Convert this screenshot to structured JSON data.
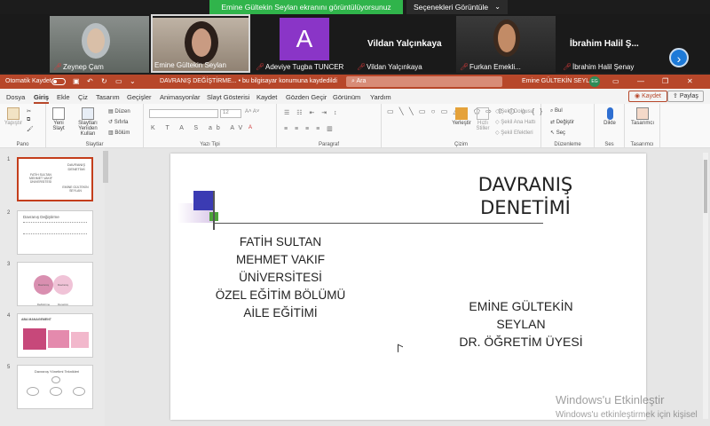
{
  "meeting": {
    "share_status": "Emine Gültekin Seylan ekranını görüntülüyorsunuz",
    "view_options": "Seçenekleri Görüntüle",
    "participants": [
      {
        "name": "Zeynep Çam"
      },
      {
        "name": "Emine Gültekin Seylan"
      },
      {
        "name": "Adeviye Tugba TUNCER",
        "avatar_letter": "A"
      },
      {
        "name": "Vildan Yalçınkaya",
        "display_name": "Vildan Yalçınkaya"
      },
      {
        "name": "Furkan Emekli..."
      },
      {
        "name": "İbrahim Halil Şenay",
        "display_name": "İbrahim  Halil  Ş..."
      }
    ]
  },
  "ppt": {
    "autosave": "Otomatik Kaydet",
    "doc_title": "DAVRANIŞ DEĞİŞTİRME...",
    "doc_status": "• bu bilgisayar konumuna kaydedildi",
    "search_placeholder": "Ara",
    "user_name": "Emine GÜLTEKİN SEYLAN",
    "user_initials": "EG",
    "menu": [
      "Dosya",
      "Giriş",
      "Ekle",
      "Çiz",
      "Tasarım",
      "Geçişler",
      "Animasyonlar",
      "Slayt Gösterisi",
      "Kaydet",
      "Gözden Geçir",
      "Görünüm",
      "Yardım"
    ],
    "save_btn": "Kaydet",
    "share_btn": "Paylaş",
    "ribbon": {
      "paste": "Yapıştır",
      "clipboard": "Pano",
      "new_slide": "Yeni Slayt",
      "reuse_slides": "Slaytları Yeniden Kullan",
      "layout": "Düzen",
      "reset": "Sıfırla",
      "section": "Bölüm",
      "slides": "Slaytlar",
      "font_size": "12",
      "font": "Yazı Tipi",
      "paragraph": "Paragraf",
      "arrange": "Yerleştir",
      "quick_styles": "Hızlı Stiller",
      "shape_fill": "Şekil Dolgusu",
      "shape_outline": "Şekil Ana Hattı",
      "shape_effects": "Şekil Efektleri",
      "drawing": "Çizim",
      "find": "Bul",
      "replace": "Değiştir",
      "select": "Seç",
      "editing": "Düzenleme",
      "dictate": "Dikte",
      "voice": "Ses",
      "designer": "Tasarımcı",
      "designer_group": "Tasarımcı"
    }
  },
  "thumbnails": [
    {
      "num": "1",
      "text_a": "DAVRANIŞ DENETİMİ",
      "text_b": "FATİH SULTAN MEHMET VAKIF ÜNİVERSİTESİ",
      "text_c": "EMİNE GÜLTEKİN SEYLAN"
    },
    {
      "num": "2",
      "text_a": "Davranış Değiştirme"
    },
    {
      "num": "3",
      "text_a": "Davranış Değiştirme",
      "text_b": "Davranış Denetimi"
    },
    {
      "num": "4",
      "text_a": "ABA MANAGEMENT"
    },
    {
      "num": "5",
      "text_a": "Davranış Yönetimi Teknikleri"
    }
  ],
  "slide": {
    "title_line1": "DAVRANIŞ",
    "title_line2": "DENETİMİ",
    "left_lines": [
      "FATİH SULTAN",
      "MEHMET VAKIF",
      "ÜNİVERSİTESİ",
      "ÖZEL EĞİTİM BÖLÜMÜ",
      "AİLE EĞİTİMİ"
    ],
    "right_lines": [
      "EMİNE GÜLTEKİN",
      "SEYLAN",
      "DR. ÖĞRETİM ÜYESİ"
    ]
  },
  "watermark": {
    "line1": "Windows'u Etkinleştir",
    "line2": "Windows'u etkinleştirmek için kişisel"
  }
}
